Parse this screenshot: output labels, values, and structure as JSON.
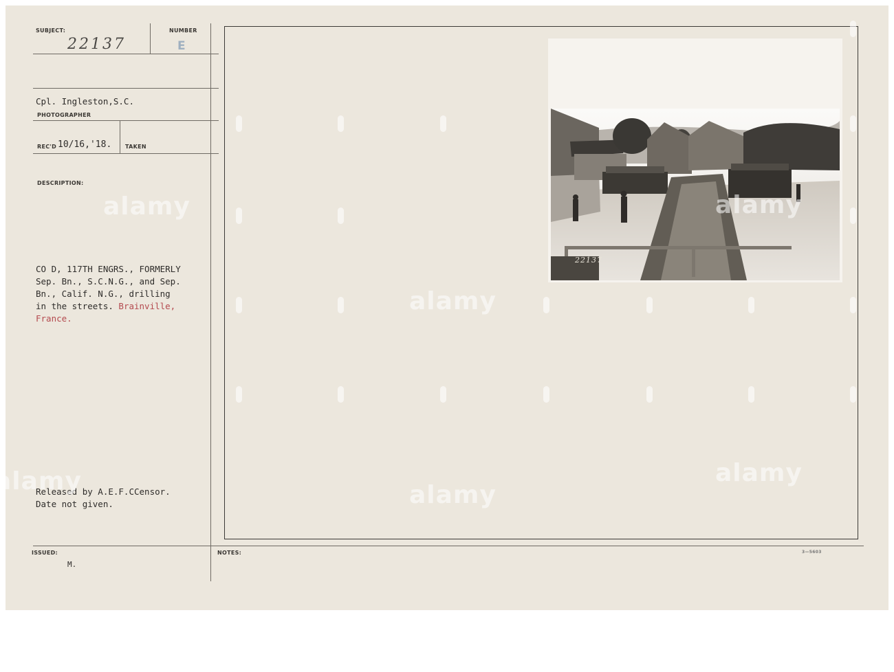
{
  "card": {
    "subject_label": "SUBJECT:",
    "number_label": "NUMBER",
    "subject_number": "22137",
    "number_stamp": "E",
    "photographer": "Cpl. Ingleston,S.C.",
    "photographer_label": "PHOTOGRAPHER",
    "recd_label": "REC'D",
    "recd_date": "10/16,'18.",
    "taken_label": "TAKEN",
    "description_label": "DESCRIPTION:",
    "description_lines": [
      "CO D, 117TH ENGRS., FORMERLY",
      "Sep. Bn., S.C.N.G., and Sep.",
      "Bn., Calif. N.G., drilling",
      "in the streets."
    ],
    "location_line1": " Brainville,",
    "location_line2": "France.",
    "released_line": "Released by A.E.F.CCensor.",
    "date_note": "Date not given.",
    "issued_label": "ISSUED:",
    "issued_value": "M.",
    "notes_label": "NOTES:",
    "form_number": "3—5603"
  },
  "photo": {
    "caption_number": "22137"
  },
  "watermark": {
    "text": "alamy"
  },
  "colors": {
    "card": "#ece7dd",
    "ink": "#2e2c2a",
    "red_ink": "#b44a4f",
    "stamp_blue": "#9fb0c0"
  }
}
